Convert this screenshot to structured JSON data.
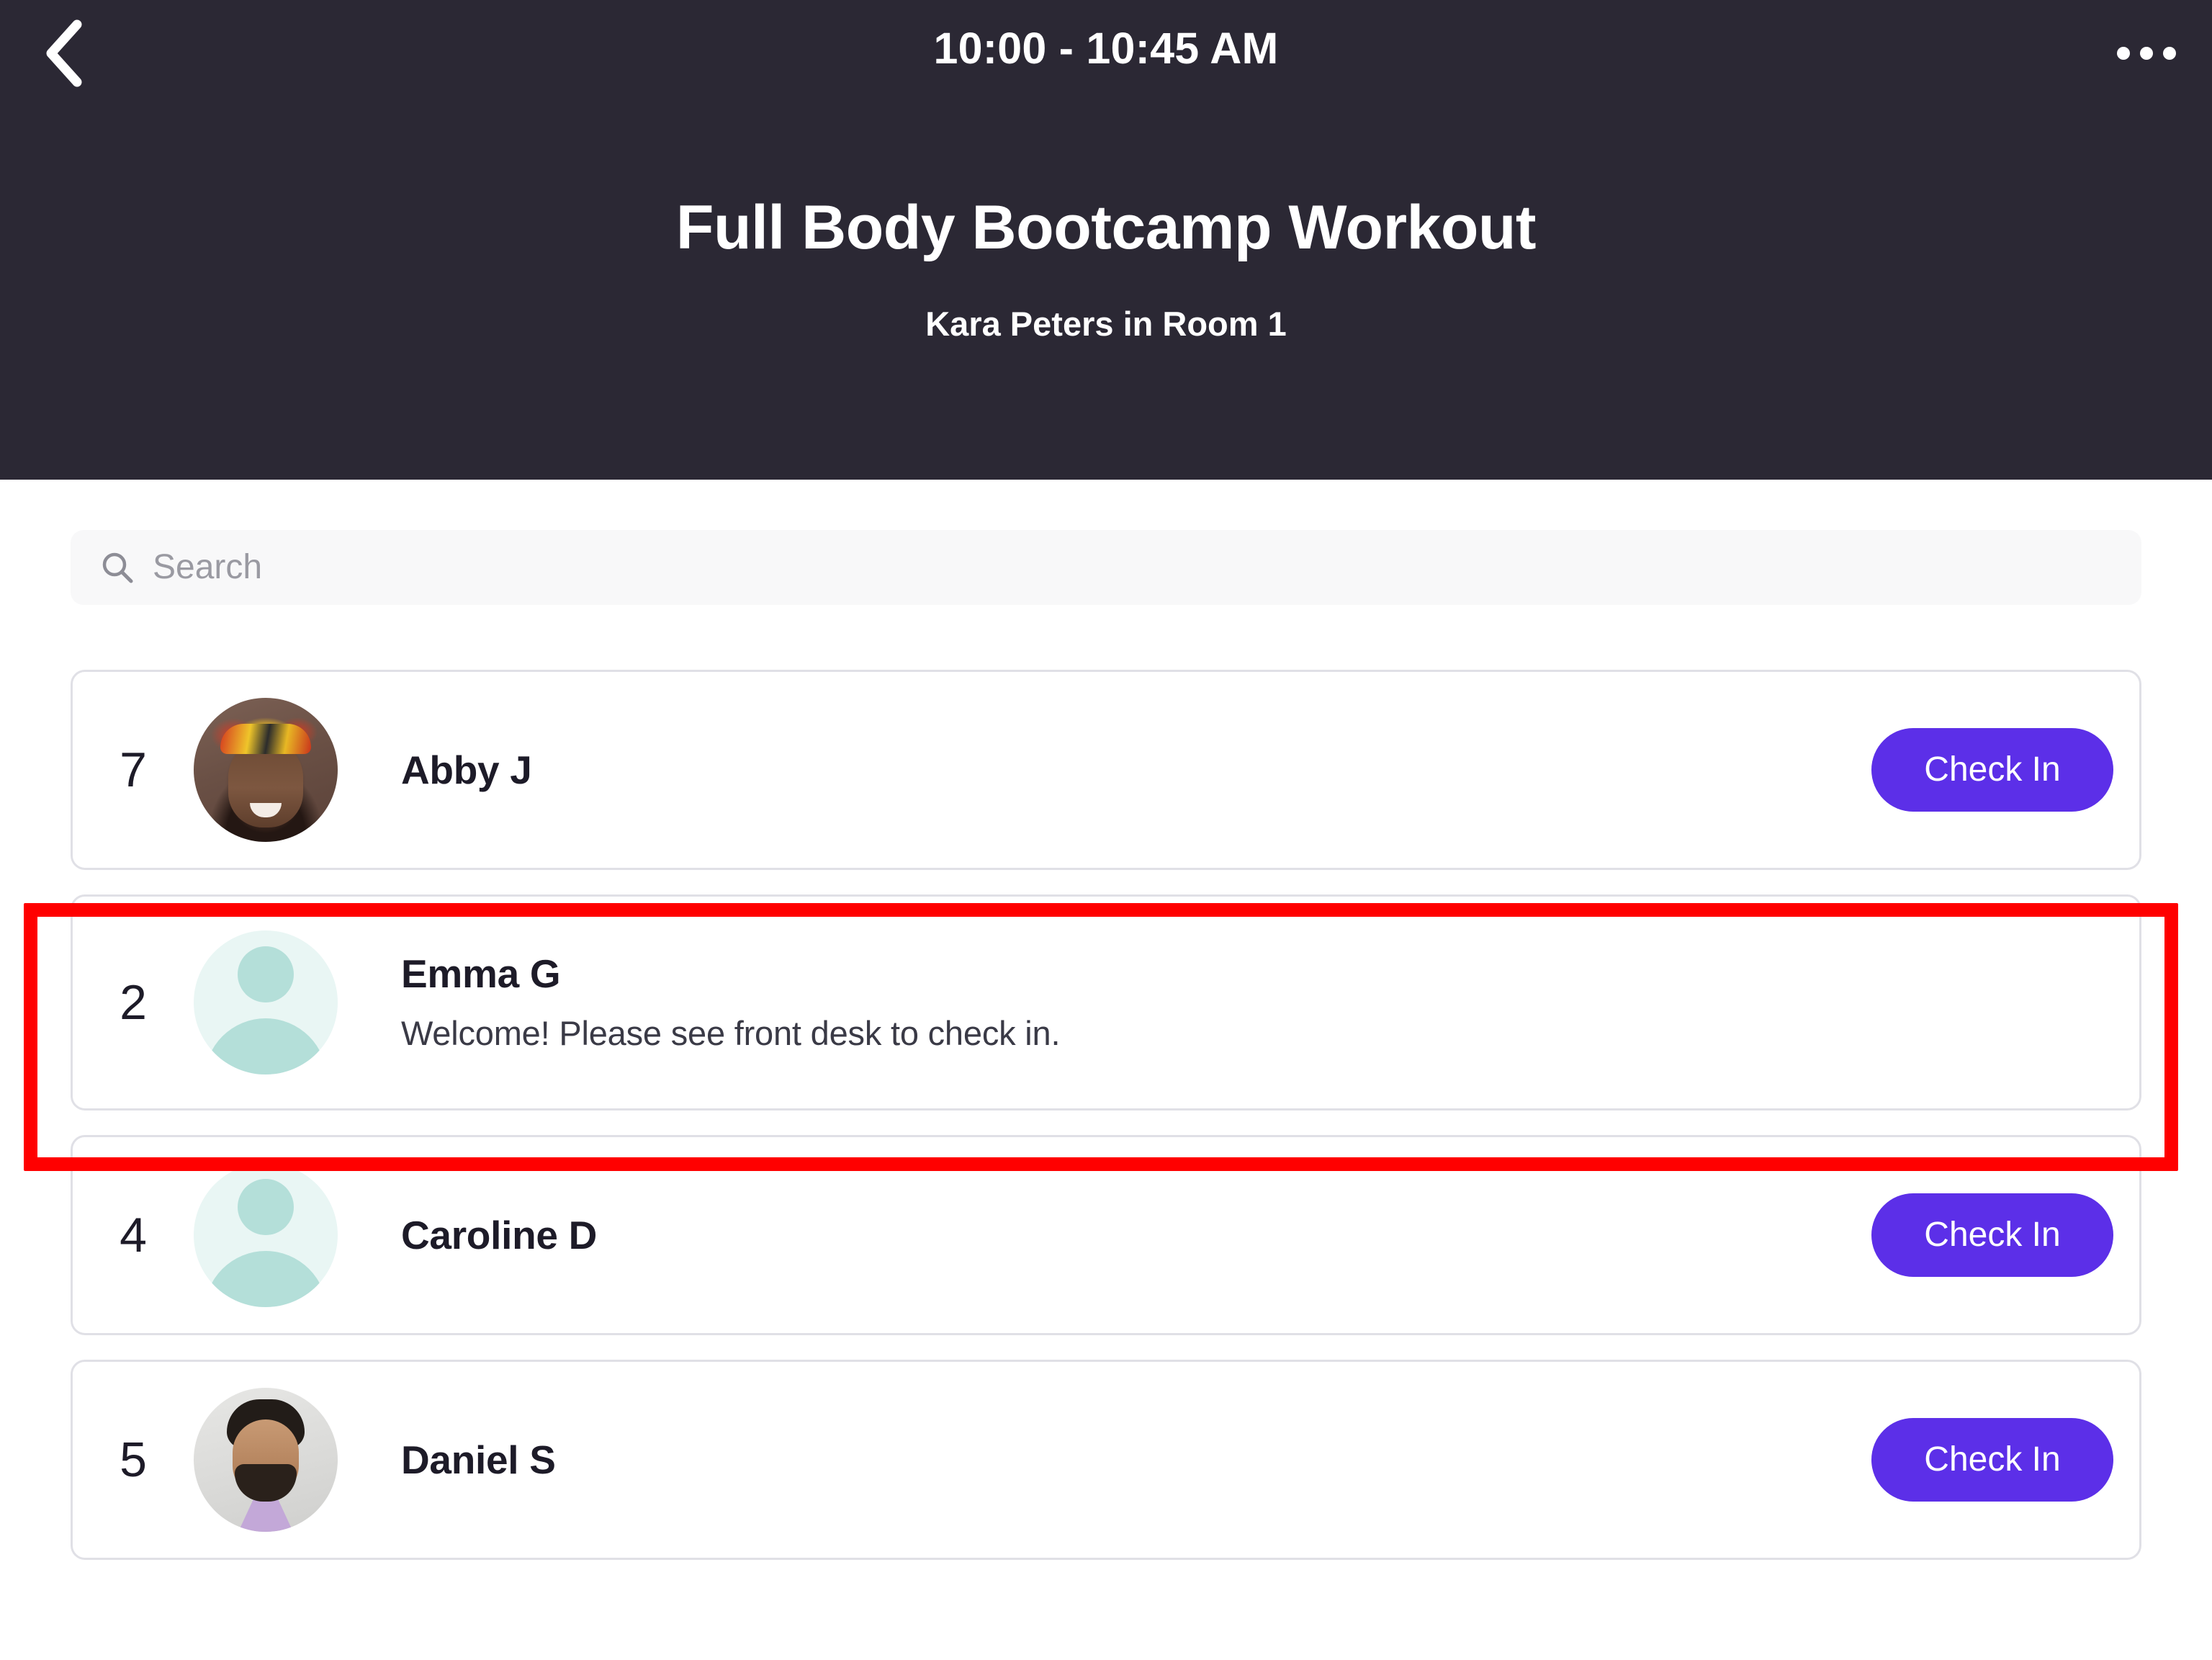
{
  "header": {
    "time_range": "10:00 - 10:45 AM",
    "title": "Full Body Bootcamp Workout",
    "subtitle": "Kara Peters in Room 1",
    "back_icon": "chevron-left-icon",
    "more_icon": "ellipsis-horizontal-icon",
    "background_color": "#2b2834"
  },
  "search": {
    "placeholder": "Search",
    "value": "",
    "icon": "search-icon",
    "background_color": "#f8f8f9"
  },
  "roster": {
    "accent_color": "#5c2fe8",
    "highlight_color": "#ff0000",
    "rows": [
      {
        "number": "7",
        "name": "Abby J",
        "note": "",
        "avatar_type": "photo",
        "avatar_variant": "photo-abby",
        "action_label": "Check In",
        "has_action": true,
        "highlighted": false
      },
      {
        "number": "2",
        "name": "Emma G",
        "note": "Welcome! Please see front desk to check in.",
        "avatar_type": "placeholder",
        "avatar_variant": "",
        "action_label": "",
        "has_action": false,
        "highlighted": true
      },
      {
        "number": "4",
        "name": "Caroline D",
        "note": "",
        "avatar_type": "placeholder",
        "avatar_variant": "",
        "action_label": "Check In",
        "has_action": true,
        "highlighted": false
      },
      {
        "number": "5",
        "name": "Daniel S",
        "note": "",
        "avatar_type": "photo",
        "avatar_variant": "photo-daniel",
        "action_label": "Check In",
        "has_action": true,
        "highlighted": false
      }
    ]
  }
}
